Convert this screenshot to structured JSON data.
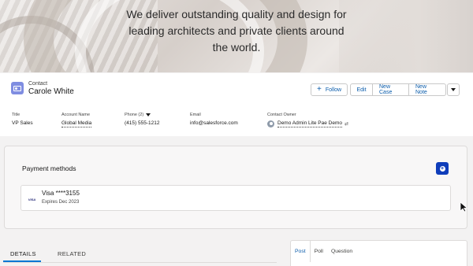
{
  "hero": {
    "lines": [
      "We deliver outstanding quality and design for",
      "leading architects and private clients around",
      "the world."
    ]
  },
  "record": {
    "object_label": "Contact",
    "name": "Carole White",
    "icon": "contact-card-icon"
  },
  "actions": {
    "follow": "Follow",
    "edit": "Edit",
    "new_case": "New Case",
    "new_note": "New Note"
  },
  "fields": {
    "title": {
      "label": "Title",
      "value": "VP Sales"
    },
    "account": {
      "label": "Account Name",
      "value": "Global Media"
    },
    "phone": {
      "label": "Phone (2)",
      "value": "(415) 555-1212"
    },
    "email": {
      "label": "Email",
      "value": "info@salesforce.com"
    },
    "owner": {
      "label": "Contact Owner",
      "value": "Demo Admin Lite Pae Demo"
    }
  },
  "payment": {
    "title": "Payment methods",
    "card_brand": "VISA",
    "card_number": "Visa ****3155",
    "expiry": "Expires Dec 2023"
  },
  "tabs": [
    {
      "label": "DETAILS",
      "active": true
    },
    {
      "label": "RELATED",
      "active": false
    }
  ],
  "feed_tabs": [
    {
      "label": "Post",
      "active": true
    },
    {
      "label": "Poll",
      "active": false
    },
    {
      "label": "Question",
      "active": false
    }
  ],
  "colors": {
    "brand": "#0176d3",
    "link": "#0b5cab",
    "contact_icon": "#7f8de1",
    "add_button": "#0f3dba"
  }
}
